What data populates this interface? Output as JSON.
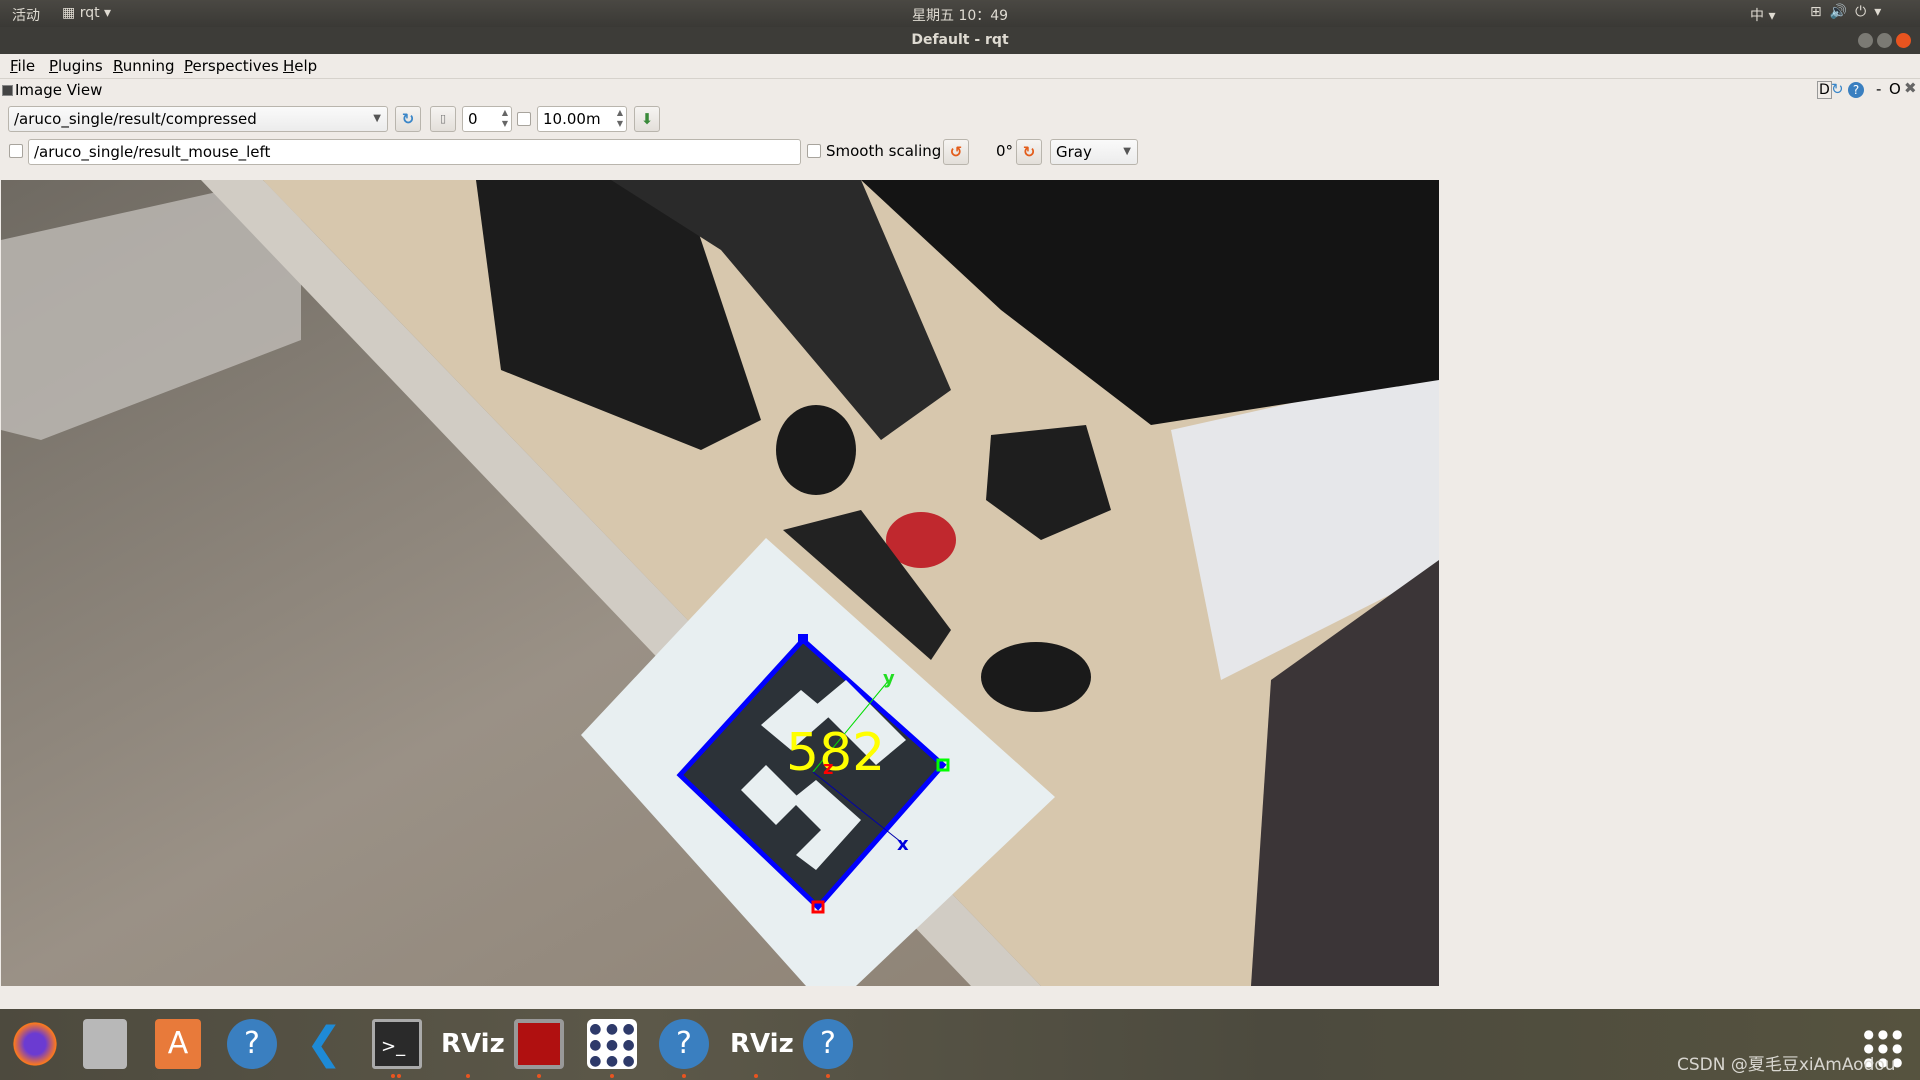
{
  "topbar": {
    "activities": "活动",
    "app": "rqt",
    "clock": "星期五 10：49",
    "ime": "中"
  },
  "window": {
    "title": "Default - rqt"
  },
  "menu": [
    "File",
    "Plugins",
    "Running",
    "Perspectives",
    "Help"
  ],
  "plugin": {
    "title": "Image View",
    "header_buttons": [
      "D",
      "reload",
      "help",
      "-",
      "O",
      "close"
    ]
  },
  "toolbar": {
    "topic": "/aruco_single/result/compressed",
    "frame_value": "0",
    "time_value": "10.00m",
    "mouse_topic": "/aruco_single/result_mouse_left",
    "smooth_scaling_label": "Smooth scaling",
    "smooth_scaling_checked": false,
    "rotation": "0°",
    "color_scheme": "Gray"
  },
  "image": {
    "marker_id": "582",
    "axis_x": "x",
    "axis_y": "y",
    "axis_z": "z",
    "colors": {
      "outline": "#0000ff",
      "text": "#ffff00",
      "corner_first": "#ff0000",
      "corner_second": "#00ff00"
    }
  },
  "dock": {
    "apps": [
      "firefox",
      "files",
      "software-center",
      "help",
      "vscode",
      "terminal",
      "RViz",
      "system-monitor",
      "rqt",
      "help",
      "RViz",
      "help"
    ],
    "show_apps": "show-applications"
  },
  "watermark": "CSDN @夏毛豆xiAmAodou"
}
